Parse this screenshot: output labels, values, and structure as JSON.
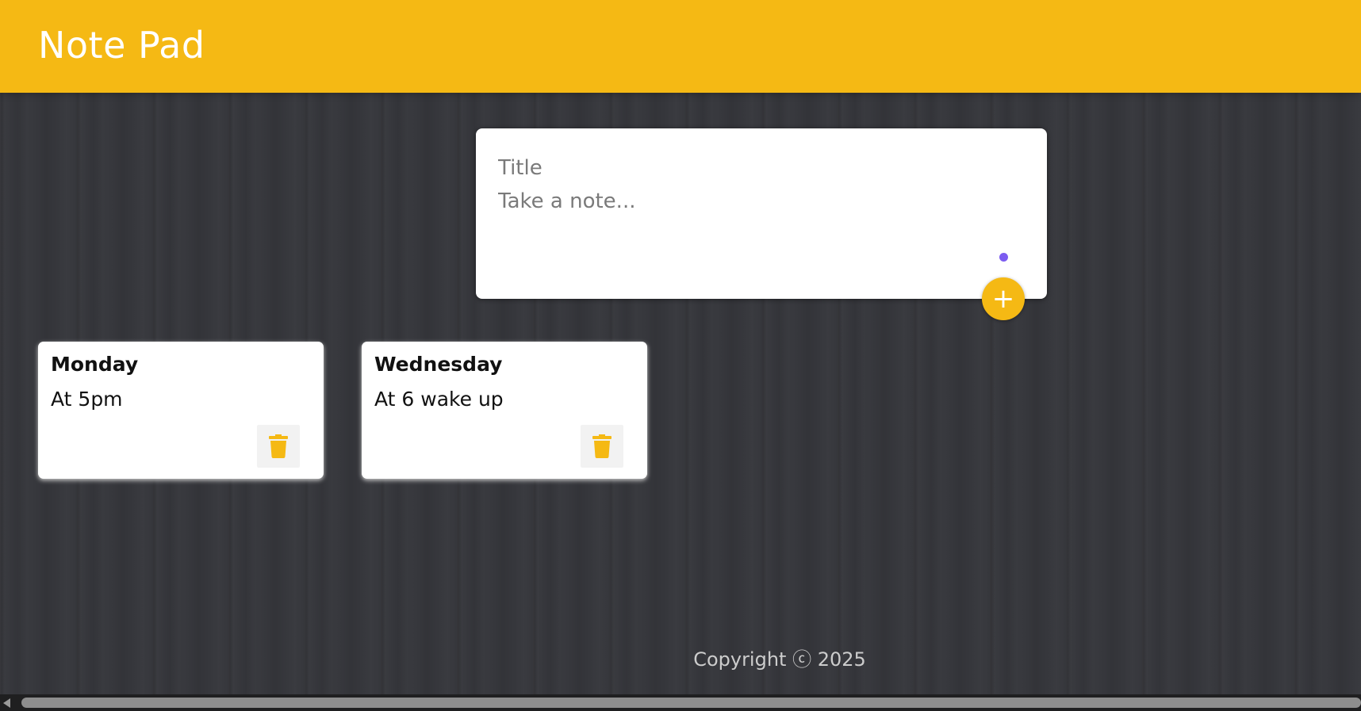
{
  "header": {
    "title": "Note Pad"
  },
  "composer": {
    "title_placeholder": "Title",
    "note_placeholder": "Take a note...",
    "add_label": "+"
  },
  "notes": [
    {
      "title": "Monday",
      "content": "At 5pm"
    },
    {
      "title": "Wednesday",
      "content": "At 6 wake up"
    }
  ],
  "footer": {
    "copyright": "Copyright ⓒ 2025"
  },
  "icons": {
    "delete": "trash-icon",
    "add": "plus-icon"
  },
  "colors": {
    "accent": "#f5b914",
    "background": "#36373c",
    "card": "#ffffff",
    "caret_dot": "#7c5cf0"
  }
}
